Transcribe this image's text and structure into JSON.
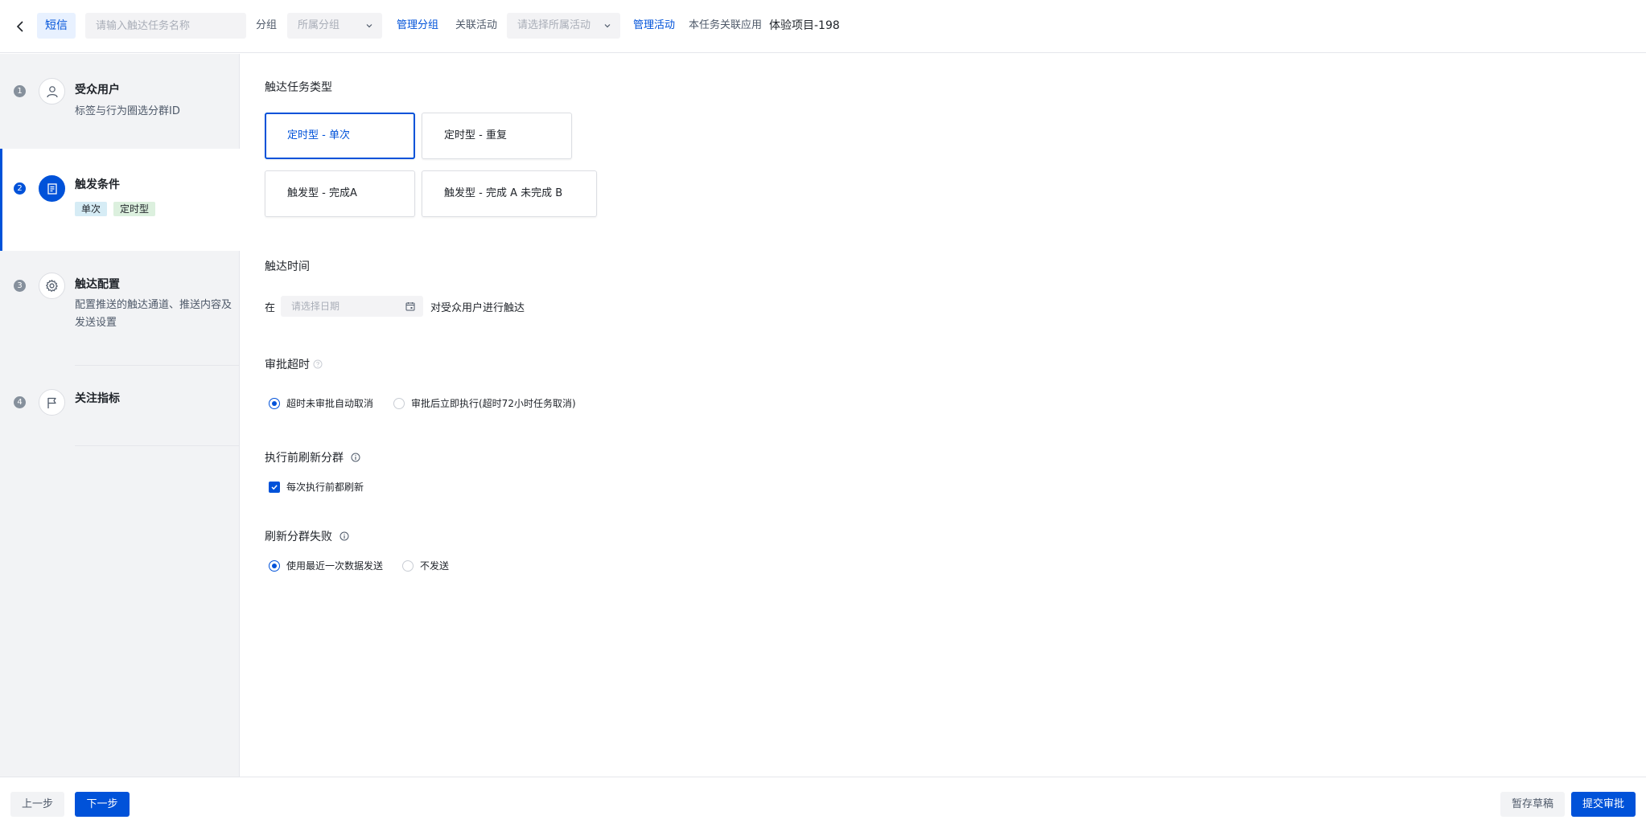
{
  "header": {
    "channel_tag": "短信",
    "task_name_placeholder": "请输入触达任务名称",
    "group_label": "分组",
    "group_select_placeholder": "所属分组",
    "manage_group_link": "管理分组",
    "activity_label": "关联活动",
    "activity_select_placeholder": "请选择所属活动",
    "manage_activity_link": "管理活动",
    "app_label": "本任务关联应用",
    "app_value": "体验项目-198"
  },
  "sidebar": {
    "steps": [
      {
        "num": "1",
        "title": "受众用户",
        "desc": "标签与行为圈选分群ID",
        "icon": "user-icon"
      },
      {
        "num": "2",
        "title": "触发条件",
        "tags": [
          "单次",
          "定时型"
        ],
        "icon": "document-icon",
        "active": true
      },
      {
        "num": "3",
        "title": "触达配置",
        "desc": "配置推送的触达通道、推送内容及发送设置",
        "icon": "gear-icon"
      },
      {
        "num": "4",
        "title": "关注指标",
        "icon": "flag-icon"
      }
    ]
  },
  "main": {
    "task_type": {
      "title": "触达任务类型",
      "options": [
        "定时型 - 单次",
        "定时型 - 重复",
        "触发型 - 完成A",
        "触发型 - 完成 A 未完成 B"
      ],
      "selected": "定时型 - 单次"
    },
    "touch_time": {
      "title": "触达时间",
      "prefix": "在",
      "date_placeholder": "请选择日期",
      "suffix": "对受众用户进行触达"
    },
    "approval_timeout": {
      "title": "审批超时",
      "options": [
        "超时未审批自动取消",
        "审批后立即执行(超时72小时任务取消)"
      ],
      "selected": "超时未审批自动取消"
    },
    "refresh_before": {
      "title": "执行前刷新分群",
      "checkbox_label": "每次执行前都刷新",
      "checked": true
    },
    "refresh_fail": {
      "title": "刷新分群失败",
      "options": [
        "使用最近一次数据发送",
        "不发送"
      ],
      "selected": "使用最近一次数据发送"
    }
  },
  "footer": {
    "prev_label": "上一步",
    "next_label": "下一步",
    "draft_label": "暂存草稿",
    "submit_label": "提交审批"
  },
  "colors": {
    "accent": "#0052d9",
    "sidebar_bg": "#f2f3f5"
  }
}
